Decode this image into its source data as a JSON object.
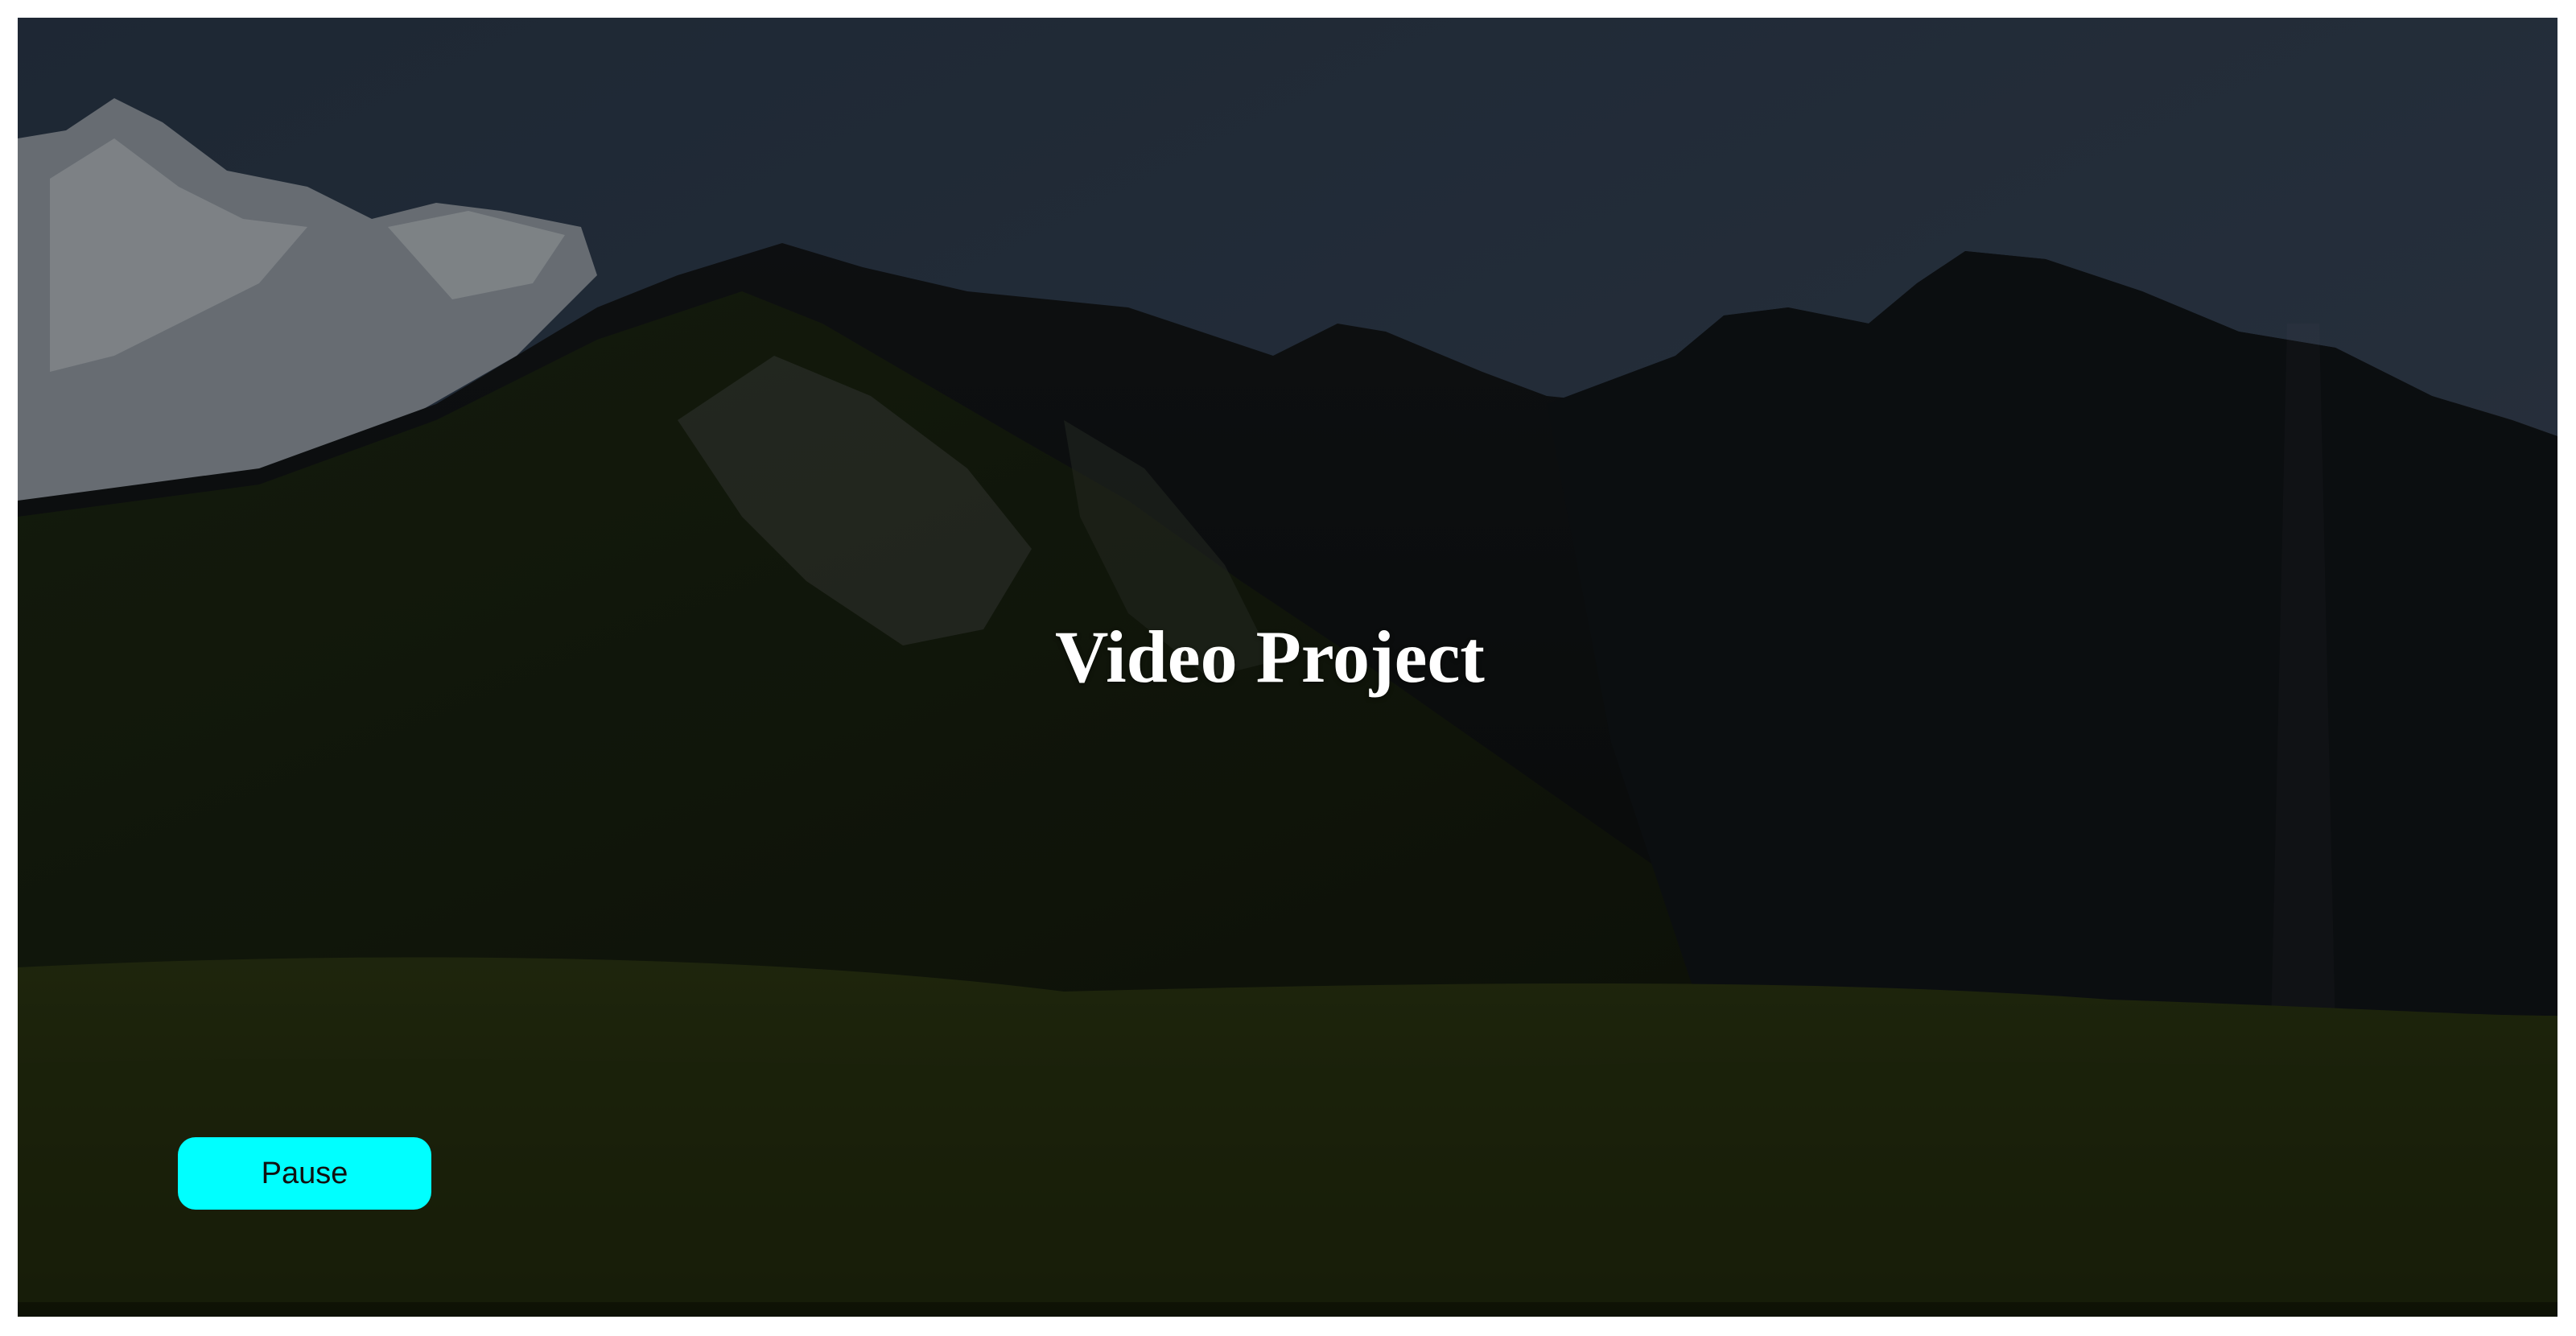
{
  "title": "Video Project",
  "controls": {
    "pause_label": "Pause"
  },
  "colors": {
    "button_background": "#00ffff",
    "title_color": "#ffffff",
    "page_background": "#ffffff"
  }
}
